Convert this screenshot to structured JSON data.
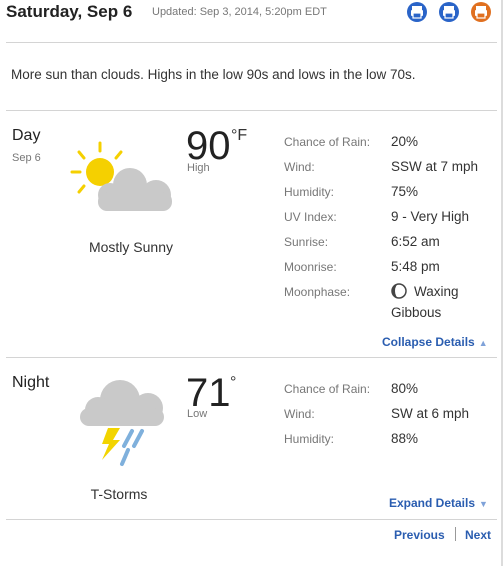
{
  "header": {
    "title": "Saturday, Sep 6",
    "updated": "Updated: Sep 3, 2014, 5:20pm EDT",
    "icons": [
      "print-icon",
      "share-icon",
      "rss-icon"
    ]
  },
  "summary": "More sun than clouds. Highs in the low 90s and lows in the low 70s.",
  "day": {
    "label": "Day",
    "date": "Sep 6",
    "temp": "90",
    "unit": "°F",
    "temp_tag": "High",
    "condition": "Mostly Sunny",
    "icon": "partly-sunny-icon",
    "details": [
      {
        "label": "Chance of Rain:",
        "value": "20%"
      },
      {
        "label": "Wind:",
        "value": "SSW at 7 mph"
      },
      {
        "label": "Humidity:",
        "value": "75%"
      },
      {
        "label": "UV Index:",
        "value": "9 - Very High"
      },
      {
        "label": "Sunrise:",
        "value": "6:52 am"
      },
      {
        "label": "Moonrise:",
        "value": "5:48 pm"
      },
      {
        "label": "Moonphase:",
        "value": "Waxing",
        "value2": "Gibbous"
      }
    ],
    "toggle_link": "Collapse Details"
  },
  "night": {
    "label": "Night",
    "temp": "71",
    "unit": "°",
    "temp_tag": "Low",
    "condition": "T-Storms",
    "icon": "thunderstorm-icon",
    "details": [
      {
        "label": "Chance of Rain:",
        "value": "80%"
      },
      {
        "label": "Wind:",
        "value": "SW at 6 mph"
      },
      {
        "label": "Humidity:",
        "value": "88%"
      }
    ],
    "toggle_link": "Expand Details"
  },
  "pager": {
    "previous": "Previous",
    "next": "Next"
  },
  "colors": {
    "link": "#2a5db0",
    "icon_blue": "#2a64c8",
    "icon_orange": "#e07020",
    "sun": "#f5d000",
    "cloud": "#c9c9c9",
    "rain": "#7fb0dc",
    "bolt": "#f2d400"
  }
}
